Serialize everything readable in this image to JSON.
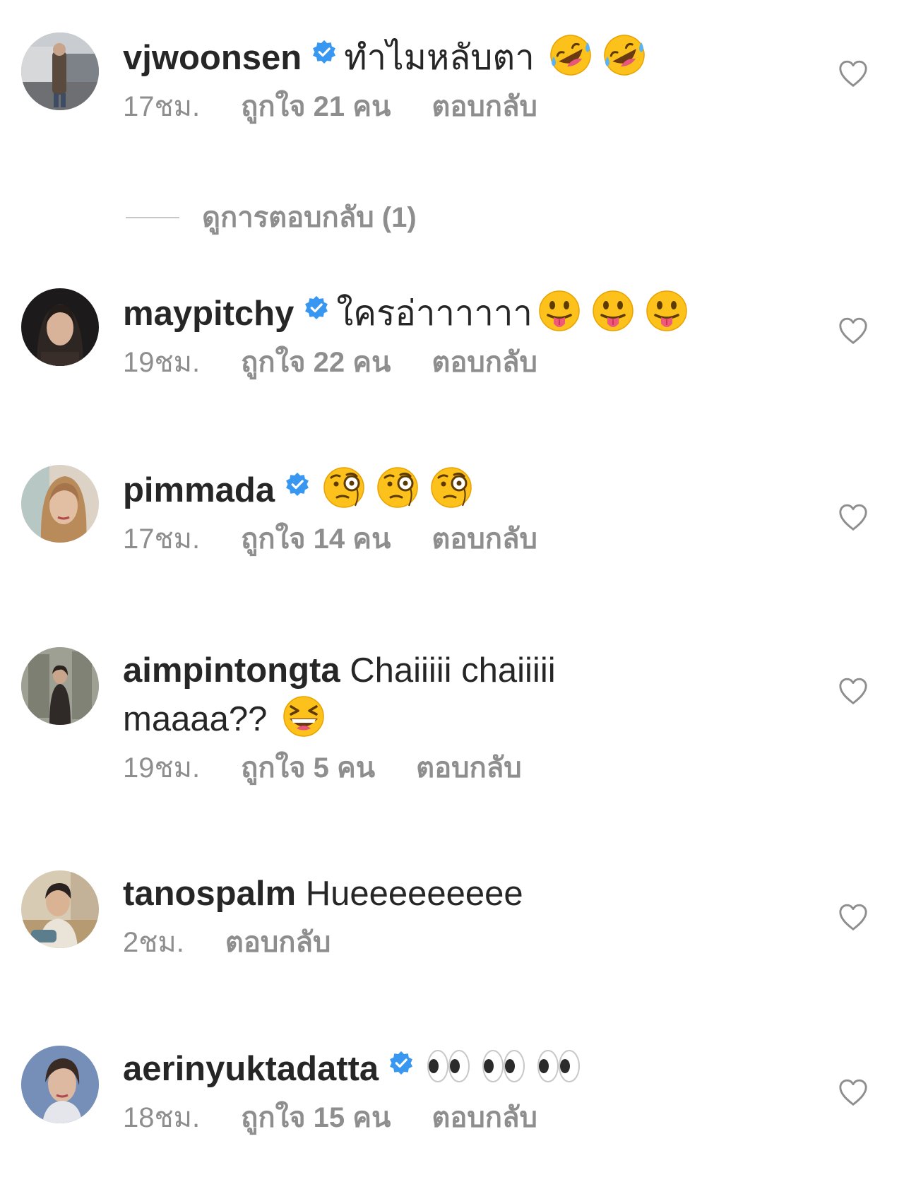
{
  "comments": [
    {
      "username": "vjwoonsen",
      "verified": true,
      "text": "ทำไมหลับตา",
      "emoji": [
        "rolling-on-floor-laughing",
        "rolling-on-floor-laughing"
      ],
      "time": "17ชม.",
      "likes": "ถูกใจ 21 คน",
      "reply": "ตอบกลับ"
    },
    {
      "username": "maypitchy",
      "verified": true,
      "text": "ใครอ่าาาาาา",
      "emoji": [
        "face-with-tongue",
        "face-with-tongue",
        "face-with-tongue"
      ],
      "time": "19ชม.",
      "likes": "ถูกใจ 22 คน",
      "reply": "ตอบกลับ"
    },
    {
      "username": "pimmada",
      "verified": true,
      "text": "",
      "emoji": [
        "face-with-monocle",
        "face-with-monocle",
        "face-with-monocle"
      ],
      "time": "17ชม.",
      "likes": "ถูกใจ 14 คน",
      "reply": "ตอบกลับ"
    },
    {
      "username": "aimpintongta",
      "verified": false,
      "text": "Chaiiiii chaiiiii maaaa??",
      "emoji": [
        "grinning-squinting-face"
      ],
      "time": "19ชม.",
      "likes": "ถูกใจ 5 คน",
      "reply": "ตอบกลับ"
    },
    {
      "username": "tanospalm",
      "verified": false,
      "text": "Hueeeeeeeee",
      "emoji": [],
      "time": "2ชม.",
      "likes": "",
      "reply": "ตอบกลับ"
    },
    {
      "username": "aerinyuktadatta",
      "verified": true,
      "text": "",
      "emoji": [
        "eyes",
        "eyes",
        "eyes"
      ],
      "time": "18ชม.",
      "likes": "ถูกใจ 15 คน",
      "reply": "ตอบกลับ"
    }
  ],
  "view_replies": "ดูการตอบกลับ (1)",
  "colors": {
    "text": "#262626",
    "meta": "#8e8e8e",
    "verified": "#3897f0",
    "heart": "#8e8e8e"
  }
}
